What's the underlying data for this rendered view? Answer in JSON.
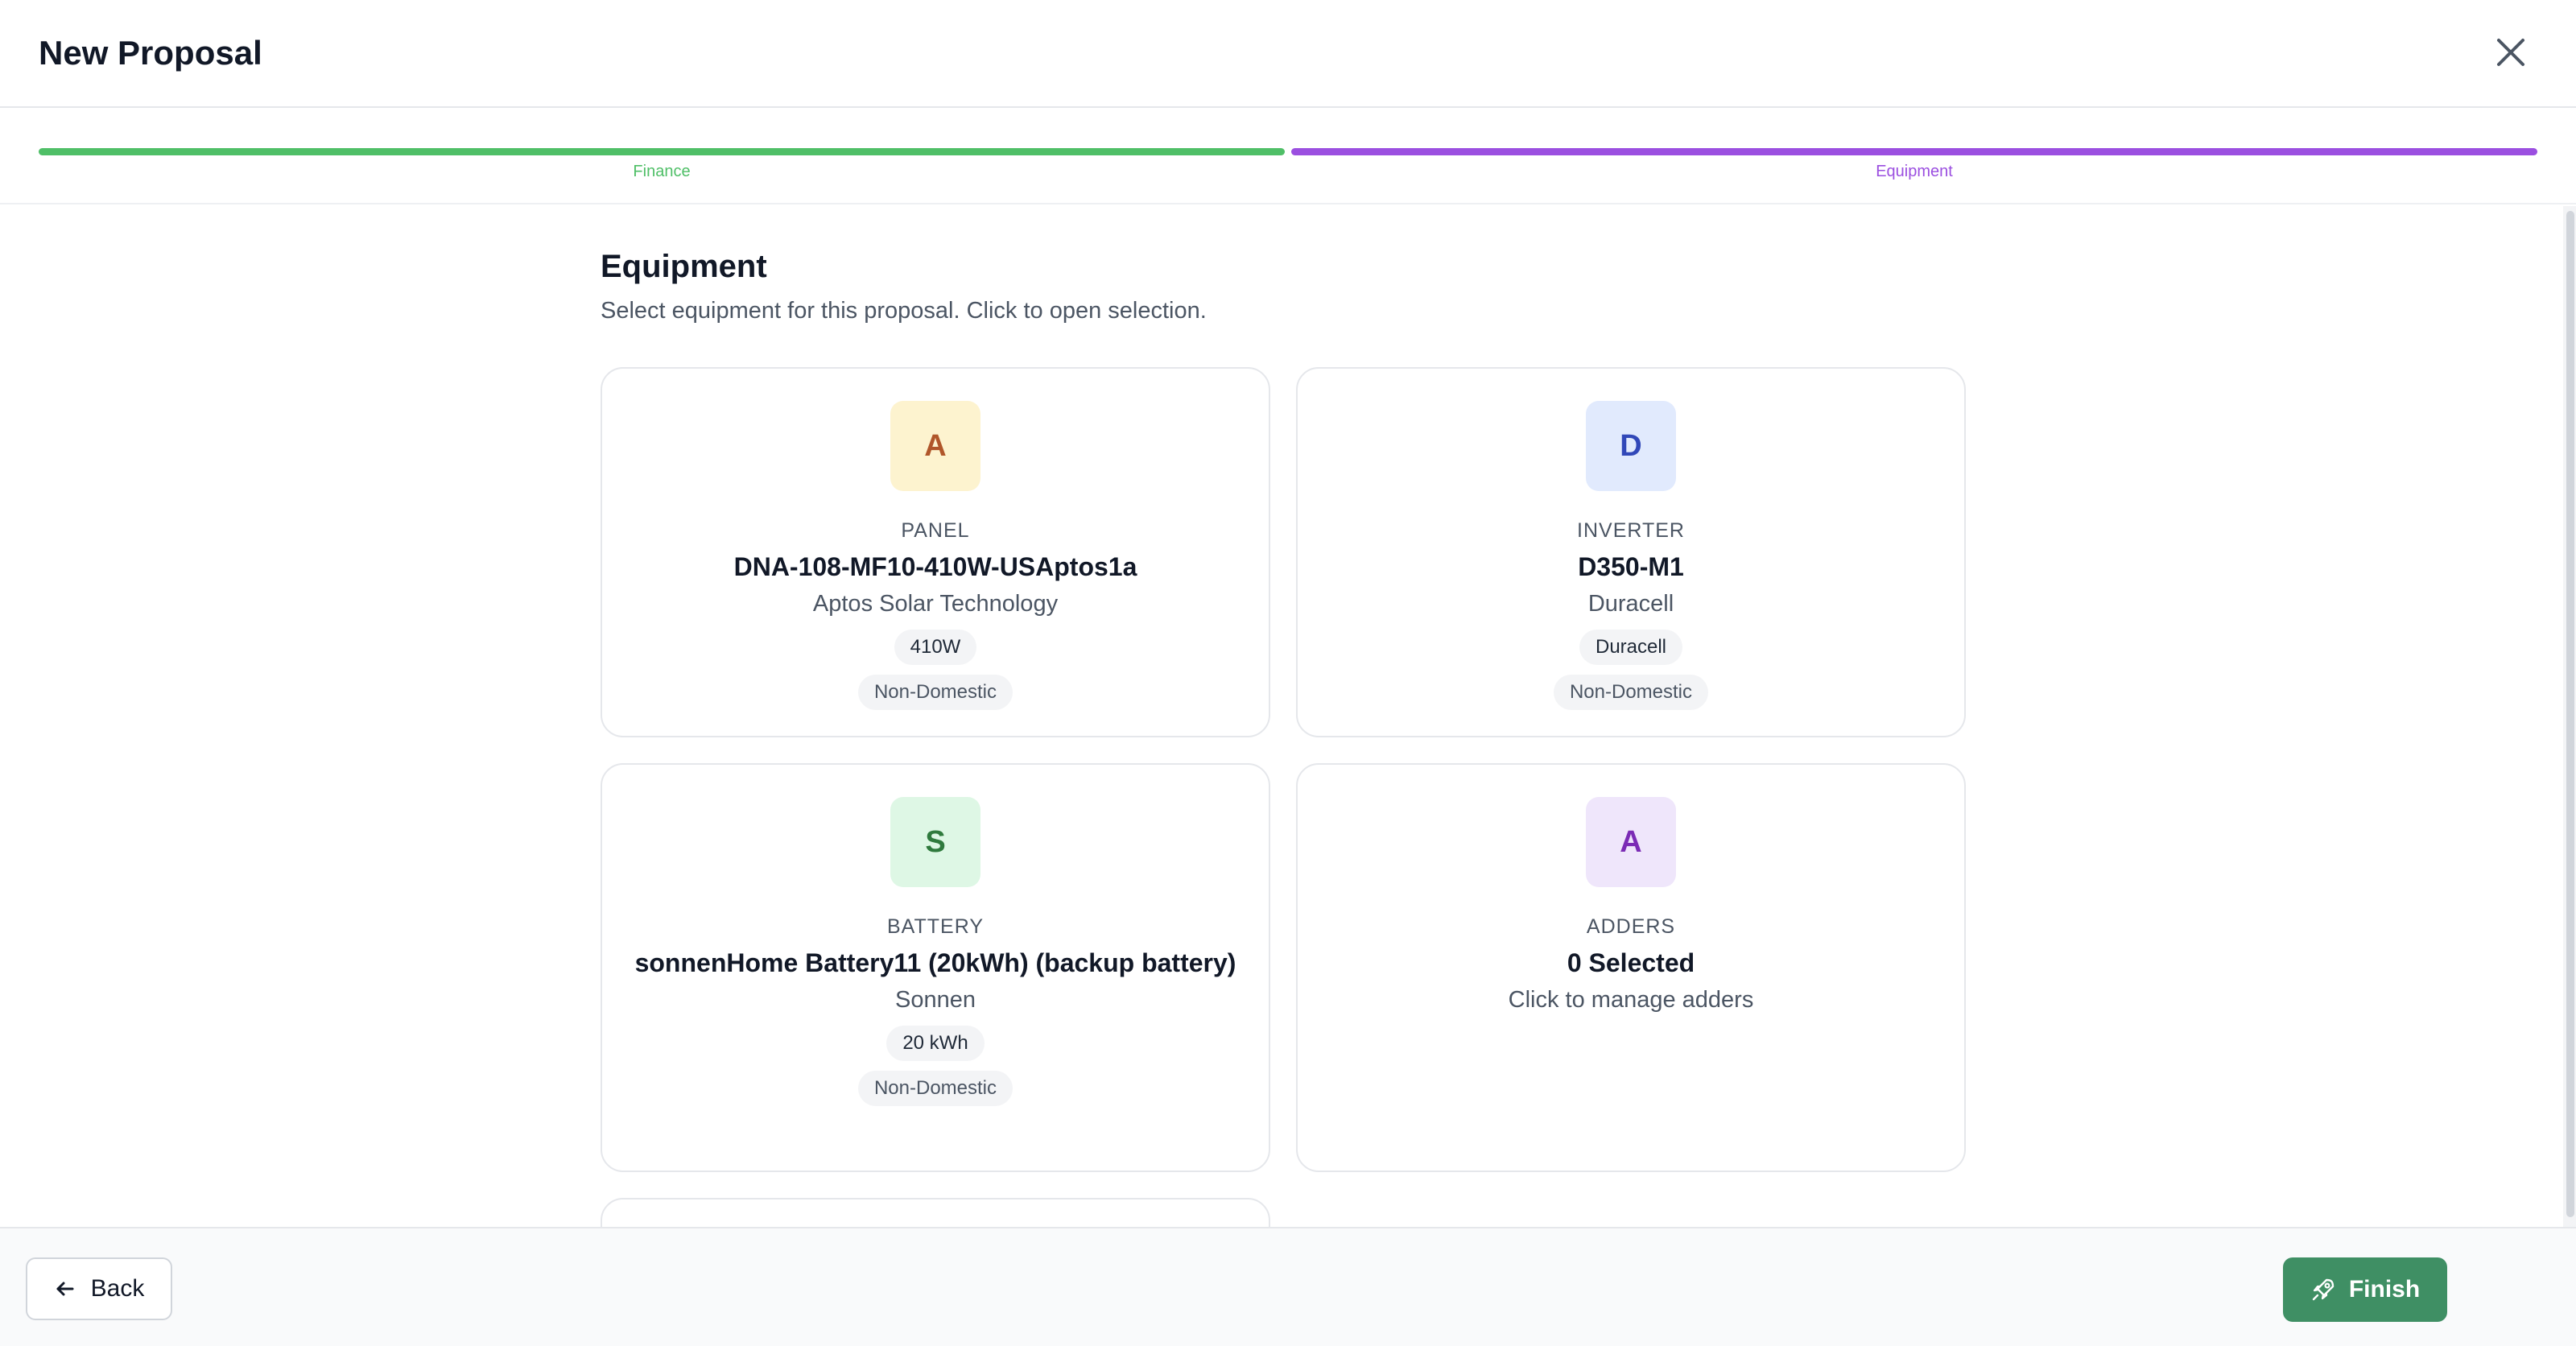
{
  "header": {
    "title": "New Proposal"
  },
  "stepper": {
    "steps": [
      {
        "label": "Finance",
        "color": "#4fbf67"
      },
      {
        "label": "Equipment",
        "color": "#9b4fe0"
      }
    ]
  },
  "main": {
    "title": "Equipment",
    "subtitle": "Select equipment for this proposal. Click to open selection.",
    "cards": [
      {
        "letter": "A",
        "kind": "PANEL",
        "name": "DNA-108-MF10-410W-USAptos1a",
        "maker": "Aptos Solar Technology",
        "chip1": "410W",
        "chip2": "Non-Domestic",
        "avatar_bg": "#fdf3cf",
        "avatar_fg": "#b0562a"
      },
      {
        "letter": "D",
        "kind": "INVERTER",
        "name": "D350-M1",
        "maker": "Duracell",
        "chip1": "Duracell",
        "chip2": "Non-Domestic",
        "avatar_bg": "#e1eafd",
        "avatar_fg": "#3148b8"
      },
      {
        "letter": "S",
        "kind": "BATTERY",
        "name": "sonnenHome Battery11 (20kWh) (backup battery)",
        "maker": "Sonnen",
        "chip1": "20 kWh",
        "chip2": "Non-Domestic",
        "avatar_bg": "#def7e5",
        "avatar_fg": "#2f7a3d"
      },
      {
        "letter": "A",
        "kind": "ADDERS",
        "name": "0 Selected",
        "maker": "Click to manage adders",
        "avatar_bg": "#efe6fb",
        "avatar_fg": "#7b2bb5"
      }
    ]
  },
  "footer": {
    "back_label": "Back",
    "finish_label": "Finish"
  }
}
